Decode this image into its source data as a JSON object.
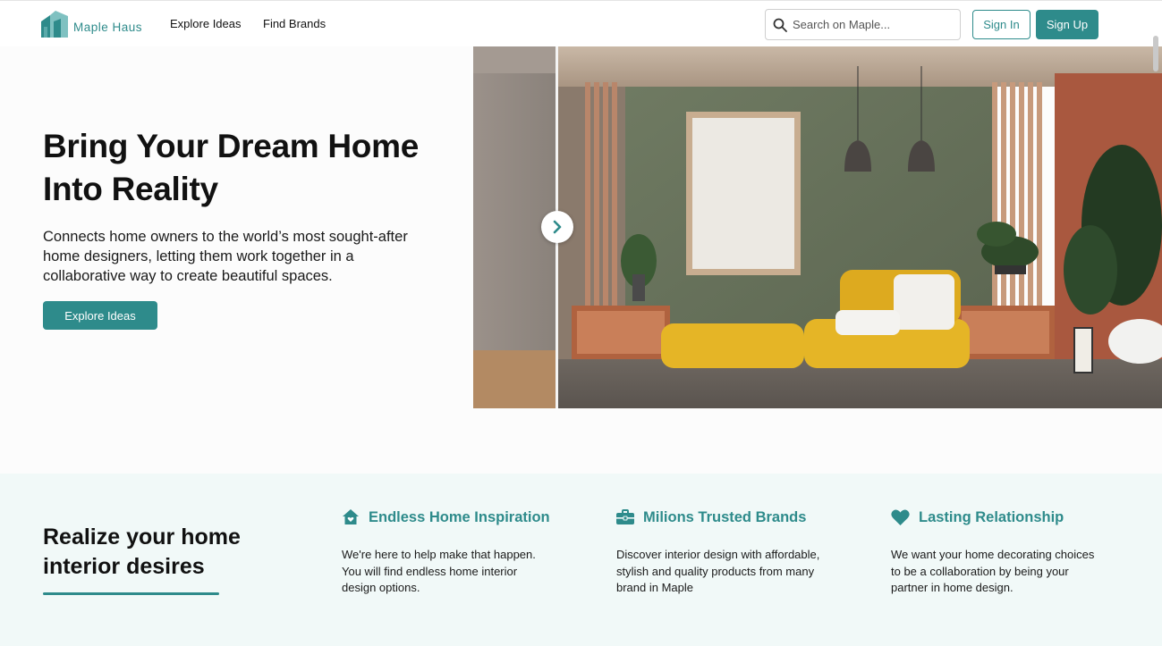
{
  "brand": {
    "name": "Maple Haus",
    "accent_color": "#2e8b8b"
  },
  "nav": {
    "links": [
      "Explore Ideas",
      "Find Brands"
    ],
    "search": {
      "placeholder": "Search on Maple...",
      "icon": "search-icon"
    },
    "sign_in_label": "Sign In",
    "sign_up_label": "Sign Up"
  },
  "hero": {
    "title": "Bring Your Dream Home Into Reality",
    "description": "Connects home owners to the world’s most sought-after home designers, letting them work together in a collaborative way to create beautiful spaces.",
    "cta_label": "Explore Ideas",
    "carousel_next_icon": "chevron-right-icon"
  },
  "features": {
    "heading": "Realize your home interior desires",
    "items": [
      {
        "icon": "home-heart-icon",
        "title": "Endless Home Inspiration",
        "text": "We're here to help make that happen. You will find endless home interior design options."
      },
      {
        "icon": "briefcase-icon",
        "title": "Milions Trusted Brands",
        "text": "Discover interior design with affordable, stylish and quality products from many brand in Maple"
      },
      {
        "icon": "heart-icon",
        "title": "Lasting Relationship",
        "text": "We want your home decorating choices to be a collaboration by being your partner in home design."
      }
    ]
  }
}
